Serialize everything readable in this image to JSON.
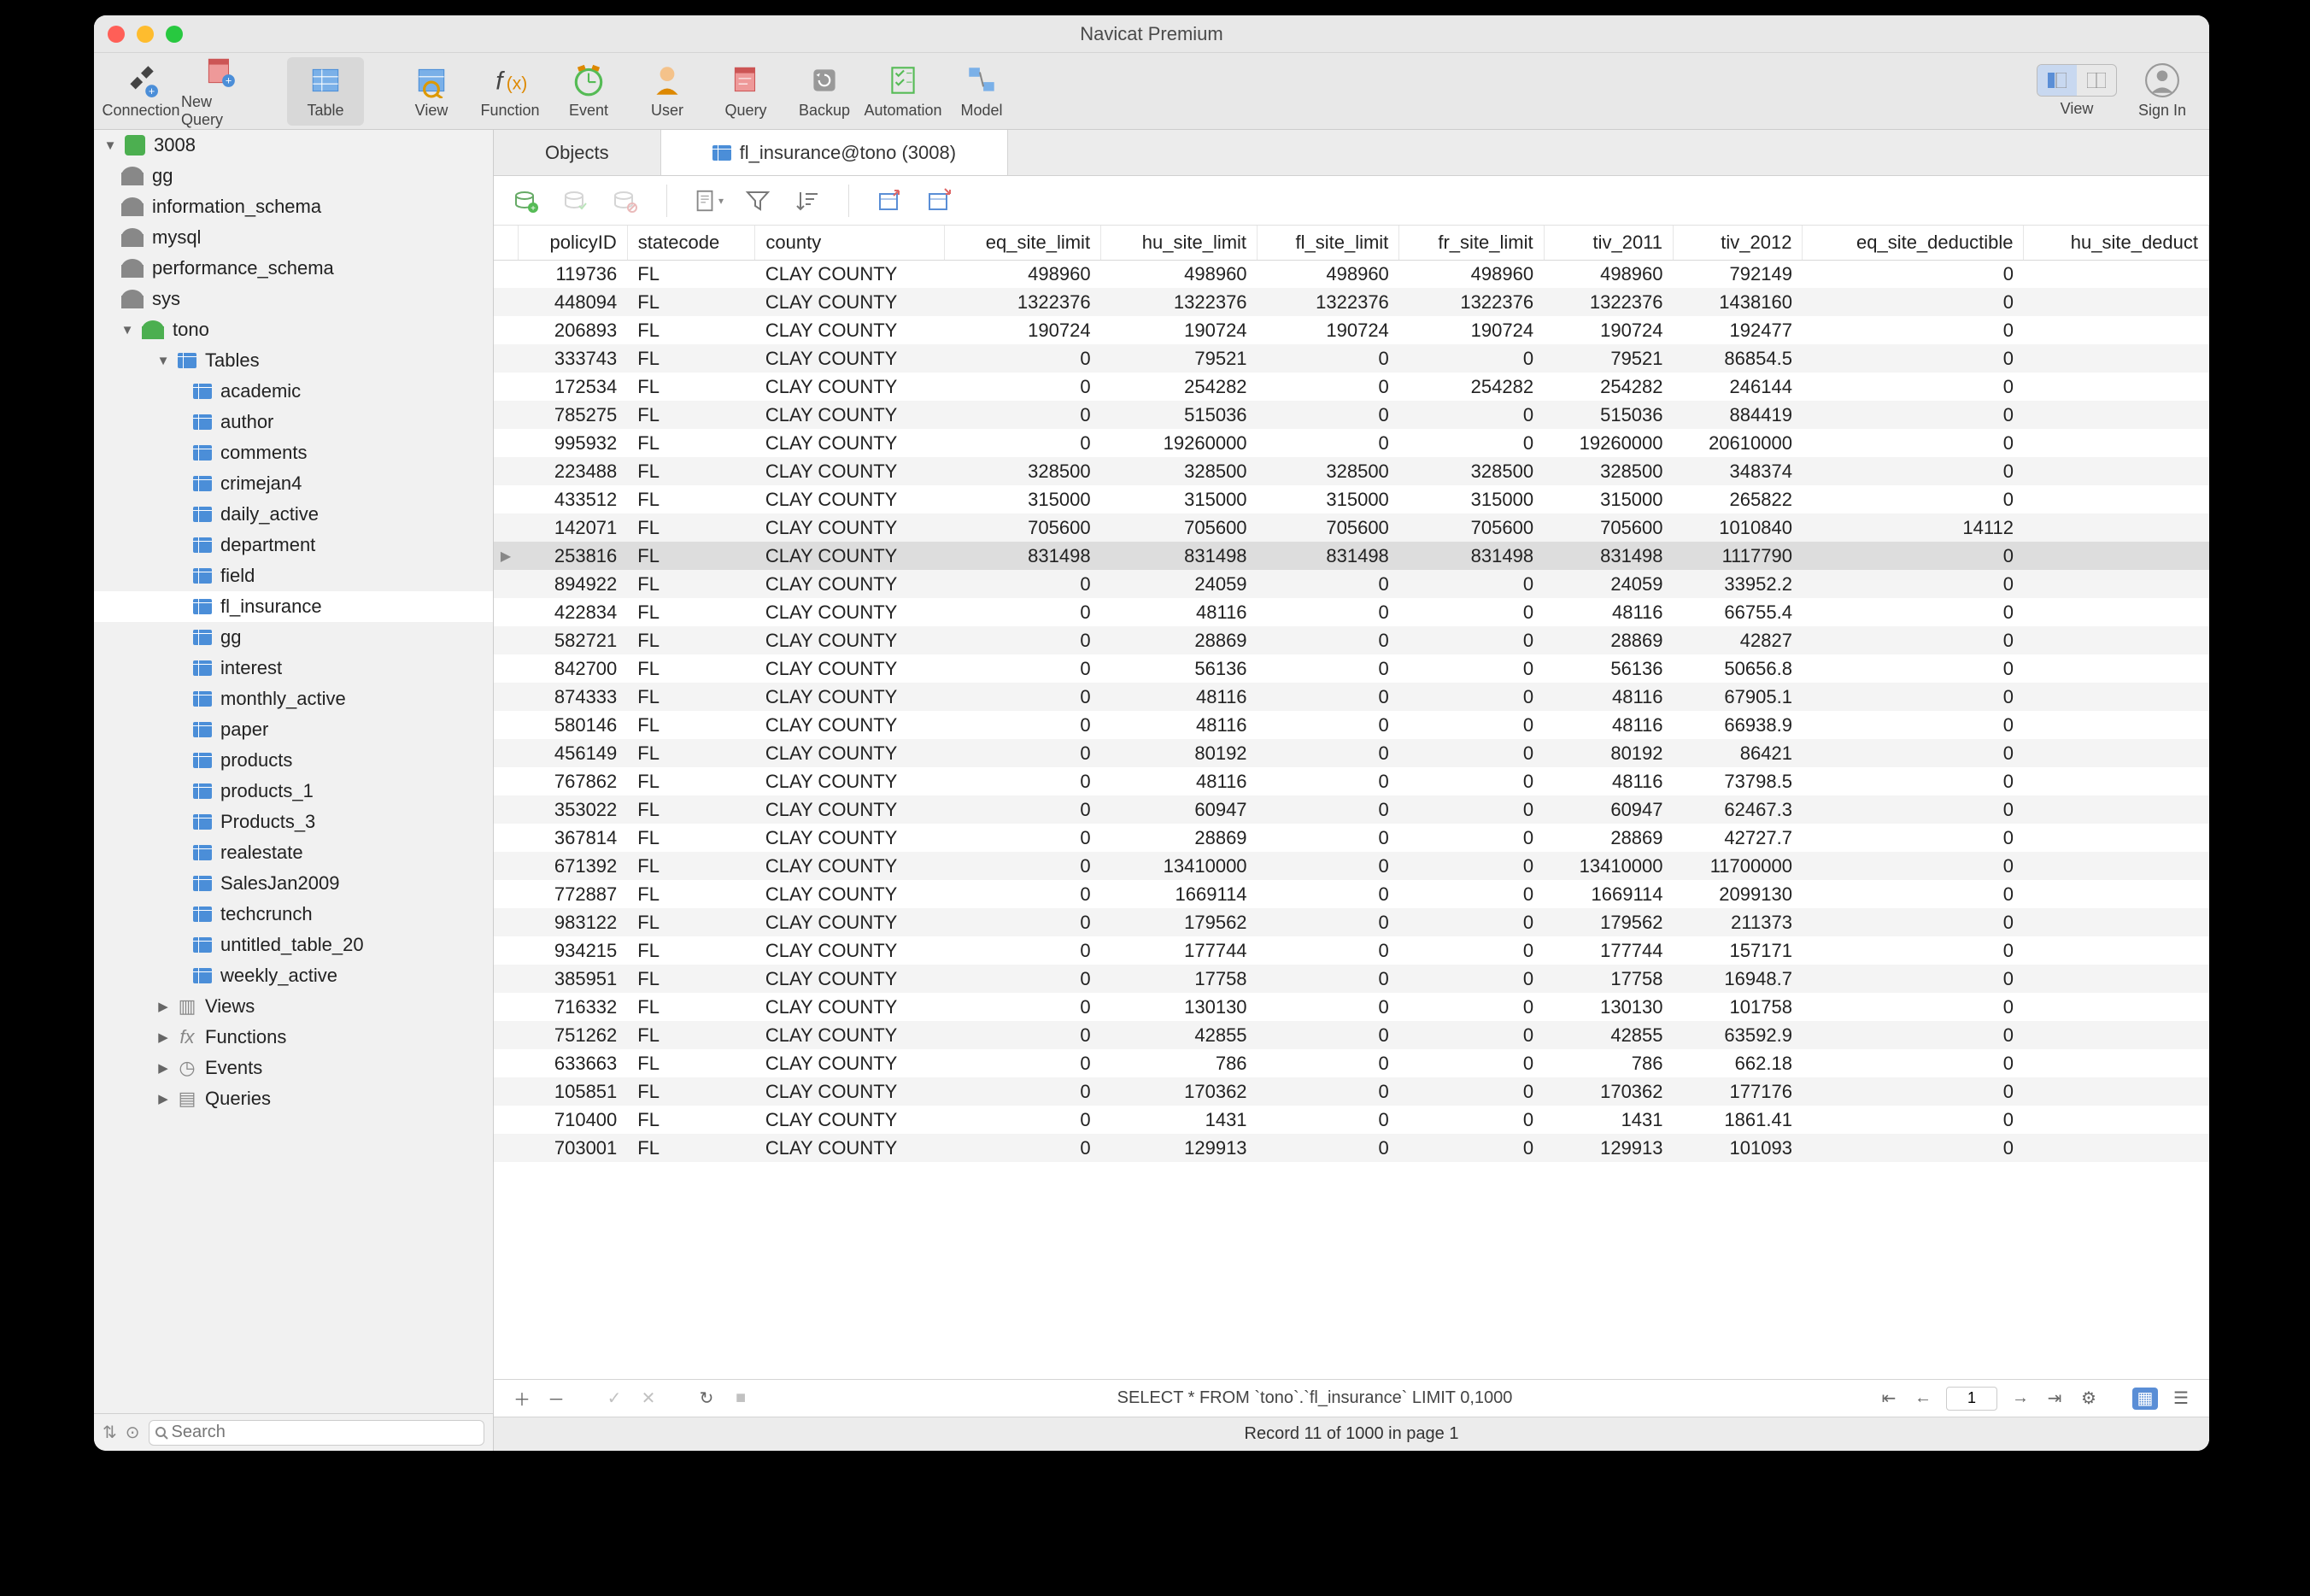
{
  "window": {
    "title": "Navicat Premium"
  },
  "toolbar": [
    {
      "label": "Connection",
      "name": "connection"
    },
    {
      "label": "New Query",
      "name": "new-query"
    },
    {
      "label": "Table",
      "name": "table",
      "selected": true
    },
    {
      "label": "View",
      "name": "view"
    },
    {
      "label": "Function",
      "name": "function"
    },
    {
      "label": "Event",
      "name": "event"
    },
    {
      "label": "User",
      "name": "user"
    },
    {
      "label": "Query",
      "name": "query"
    },
    {
      "label": "Backup",
      "name": "backup"
    },
    {
      "label": "Automation",
      "name": "automation"
    },
    {
      "label": "Model",
      "name": "model"
    }
  ],
  "toolbar_right": {
    "view": "View",
    "signin": "Sign In"
  },
  "sidebar": {
    "connection": "3008",
    "dbs": [
      "gg",
      "information_schema",
      "mysql",
      "performance_schema",
      "sys"
    ],
    "active_db": "tono",
    "tables_label": "Tables",
    "tables": [
      "academic",
      "author",
      "comments",
      "crimejan4",
      "daily_active",
      "department",
      "field",
      "fl_insurance",
      "gg",
      "interest",
      "monthly_active",
      "paper",
      "products",
      "products_1",
      "Products_3",
      "realestate",
      "SalesJan2009",
      "techcrunch",
      "untitled_table_20",
      "weekly_active"
    ],
    "selected_table": "fl_insurance",
    "folders": [
      "Views",
      "Functions",
      "Events",
      "Queries"
    ],
    "search_placeholder": "Search"
  },
  "tabs": [
    {
      "label": "Objects",
      "active": false
    },
    {
      "label": "fl_insurance@tono (3008)",
      "active": true,
      "icon": true
    }
  ],
  "columns": [
    "policyID",
    "statecode",
    "county",
    "eq_site_limit",
    "hu_site_limit",
    "fl_site_limit",
    "fr_site_limit",
    "tiv_2011",
    "tiv_2012",
    "eq_site_deductible",
    "hu_site_deduct"
  ],
  "col_align": [
    "num",
    "",
    "",
    "num",
    "num",
    "num",
    "num",
    "num",
    "num",
    "num",
    "num"
  ],
  "rows": [
    [
      "119736",
      "FL",
      "CLAY COUNTY",
      "498960",
      "498960",
      "498960",
      "498960",
      "498960",
      "792149",
      "0",
      ""
    ],
    [
      "448094",
      "FL",
      "CLAY COUNTY",
      "1322376",
      "1322376",
      "1322376",
      "1322376",
      "1322376",
      "1438160",
      "0",
      ""
    ],
    [
      "206893",
      "FL",
      "CLAY COUNTY",
      "190724",
      "190724",
      "190724",
      "190724",
      "190724",
      "192477",
      "0",
      ""
    ],
    [
      "333743",
      "FL",
      "CLAY COUNTY",
      "0",
      "79521",
      "0",
      "0",
      "79521",
      "86854.5",
      "0",
      ""
    ],
    [
      "172534",
      "FL",
      "CLAY COUNTY",
      "0",
      "254282",
      "0",
      "254282",
      "254282",
      "246144",
      "0",
      ""
    ],
    [
      "785275",
      "FL",
      "CLAY COUNTY",
      "0",
      "515036",
      "0",
      "0",
      "515036",
      "884419",
      "0",
      ""
    ],
    [
      "995932",
      "FL",
      "CLAY COUNTY",
      "0",
      "19260000",
      "0",
      "0",
      "19260000",
      "20610000",
      "0",
      ""
    ],
    [
      "223488",
      "FL",
      "CLAY COUNTY",
      "328500",
      "328500",
      "328500",
      "328500",
      "328500",
      "348374",
      "0",
      ""
    ],
    [
      "433512",
      "FL",
      "CLAY COUNTY",
      "315000",
      "315000",
      "315000",
      "315000",
      "315000",
      "265822",
      "0",
      ""
    ],
    [
      "142071",
      "FL",
      "CLAY COUNTY",
      "705600",
      "705600",
      "705600",
      "705600",
      "705600",
      "1010840",
      "14112",
      ""
    ],
    [
      "253816",
      "FL",
      "CLAY COUNTY",
      "831498",
      "831498",
      "831498",
      "831498",
      "831498",
      "1117790",
      "0",
      ""
    ],
    [
      "894922",
      "FL",
      "CLAY COUNTY",
      "0",
      "24059",
      "0",
      "0",
      "24059",
      "33952.2",
      "0",
      ""
    ],
    [
      "422834",
      "FL",
      "CLAY COUNTY",
      "0",
      "48116",
      "0",
      "0",
      "48116",
      "66755.4",
      "0",
      ""
    ],
    [
      "582721",
      "FL",
      "CLAY COUNTY",
      "0",
      "28869",
      "0",
      "0",
      "28869",
      "42827",
      "0",
      ""
    ],
    [
      "842700",
      "FL",
      "CLAY COUNTY",
      "0",
      "56136",
      "0",
      "0",
      "56136",
      "50656.8",
      "0",
      ""
    ],
    [
      "874333",
      "FL",
      "CLAY COUNTY",
      "0",
      "48116",
      "0",
      "0",
      "48116",
      "67905.1",
      "0",
      ""
    ],
    [
      "580146",
      "FL",
      "CLAY COUNTY",
      "0",
      "48116",
      "0",
      "0",
      "48116",
      "66938.9",
      "0",
      ""
    ],
    [
      "456149",
      "FL",
      "CLAY COUNTY",
      "0",
      "80192",
      "0",
      "0",
      "80192",
      "86421",
      "0",
      ""
    ],
    [
      "767862",
      "FL",
      "CLAY COUNTY",
      "0",
      "48116",
      "0",
      "0",
      "48116",
      "73798.5",
      "0",
      ""
    ],
    [
      "353022",
      "FL",
      "CLAY COUNTY",
      "0",
      "60947",
      "0",
      "0",
      "60947",
      "62467.3",
      "0",
      ""
    ],
    [
      "367814",
      "FL",
      "CLAY COUNTY",
      "0",
      "28869",
      "0",
      "0",
      "28869",
      "42727.7",
      "0",
      ""
    ],
    [
      "671392",
      "FL",
      "CLAY COUNTY",
      "0",
      "13410000",
      "0",
      "0",
      "13410000",
      "11700000",
      "0",
      ""
    ],
    [
      "772887",
      "FL",
      "CLAY COUNTY",
      "0",
      "1669114",
      "0",
      "0",
      "1669114",
      "2099130",
      "0",
      ""
    ],
    [
      "983122",
      "FL",
      "CLAY COUNTY",
      "0",
      "179562",
      "0",
      "0",
      "179562",
      "211373",
      "0",
      ""
    ],
    [
      "934215",
      "FL",
      "CLAY COUNTY",
      "0",
      "177744",
      "0",
      "0",
      "177744",
      "157171",
      "0",
      ""
    ],
    [
      "385951",
      "FL",
      "CLAY COUNTY",
      "0",
      "17758",
      "0",
      "0",
      "17758",
      "16948.7",
      "0",
      ""
    ],
    [
      "716332",
      "FL",
      "CLAY COUNTY",
      "0",
      "130130",
      "0",
      "0",
      "130130",
      "101758",
      "0",
      ""
    ],
    [
      "751262",
      "FL",
      "CLAY COUNTY",
      "0",
      "42855",
      "0",
      "0",
      "42855",
      "63592.9",
      "0",
      ""
    ],
    [
      "633663",
      "FL",
      "CLAY COUNTY",
      "0",
      "786",
      "0",
      "0",
      "786",
      "662.18",
      "0",
      ""
    ],
    [
      "105851",
      "FL",
      "CLAY COUNTY",
      "0",
      "170362",
      "0",
      "0",
      "170362",
      "177176",
      "0",
      ""
    ],
    [
      "710400",
      "FL",
      "CLAY COUNTY",
      "0",
      "1431",
      "0",
      "0",
      "1431",
      "1861.41",
      "0",
      ""
    ],
    [
      "703001",
      "FL",
      "CLAY COUNTY",
      "0",
      "129913",
      "0",
      "0",
      "129913",
      "101093",
      "0",
      ""
    ]
  ],
  "selected_row": 10,
  "footer": {
    "sql": "SELECT * FROM `tono`.`fl_insurance` LIMIT 0,1000",
    "page": "1"
  },
  "status": "Record 11 of 1000 in page 1"
}
